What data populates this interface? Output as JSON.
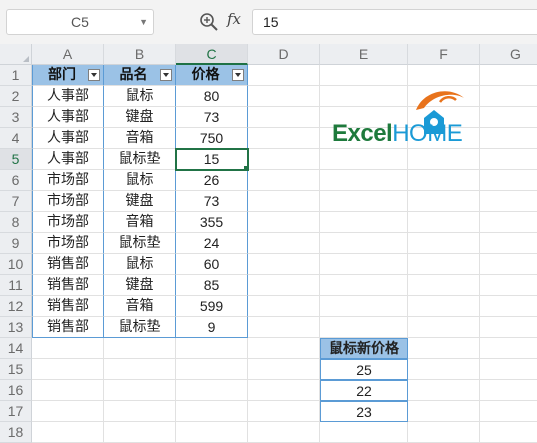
{
  "formula_bar": {
    "name_box": "C5",
    "fx_label": "fx",
    "value": "15"
  },
  "columns": [
    "A",
    "B",
    "C",
    "D",
    "E",
    "F",
    "G"
  ],
  "rows": [
    "1",
    "2",
    "3",
    "4",
    "5",
    "6",
    "7",
    "8",
    "9",
    "10",
    "11",
    "12",
    "13",
    "14",
    "15",
    "16",
    "17",
    "18"
  ],
  "table": {
    "headers": [
      "部门",
      "品名",
      "价格"
    ],
    "rows": [
      [
        "人事部",
        "鼠标",
        "80"
      ],
      [
        "人事部",
        "键盘",
        "73"
      ],
      [
        "人事部",
        "音箱",
        "750"
      ],
      [
        "人事部",
        "鼠标垫",
        "15"
      ],
      [
        "市场部",
        "鼠标",
        "26"
      ],
      [
        "市场部",
        "键盘",
        "73"
      ],
      [
        "市场部",
        "音箱",
        "355"
      ],
      [
        "市场部",
        "鼠标垫",
        "24"
      ],
      [
        "销售部",
        "鼠标",
        "60"
      ],
      [
        "销售部",
        "键盘",
        "85"
      ],
      [
        "销售部",
        "音箱",
        "599"
      ],
      [
        "销售部",
        "鼠标垫",
        "9"
      ]
    ]
  },
  "side_table": {
    "header": "鼠标新价格",
    "values": [
      "25",
      "22",
      "23"
    ]
  },
  "logo": {
    "text_excel": "Excel",
    "text_home": "HOME"
  },
  "selection": {
    "cell": "C5",
    "column": "C",
    "row": "5"
  },
  "colors": {
    "header_fill": "#9bc2e6",
    "table_border": "#5b9bd5",
    "selection": "#217346",
    "logo_orange": "#e8731c",
    "logo_green": "#1e7a3c",
    "logo_blue": "#1a9ad6"
  }
}
